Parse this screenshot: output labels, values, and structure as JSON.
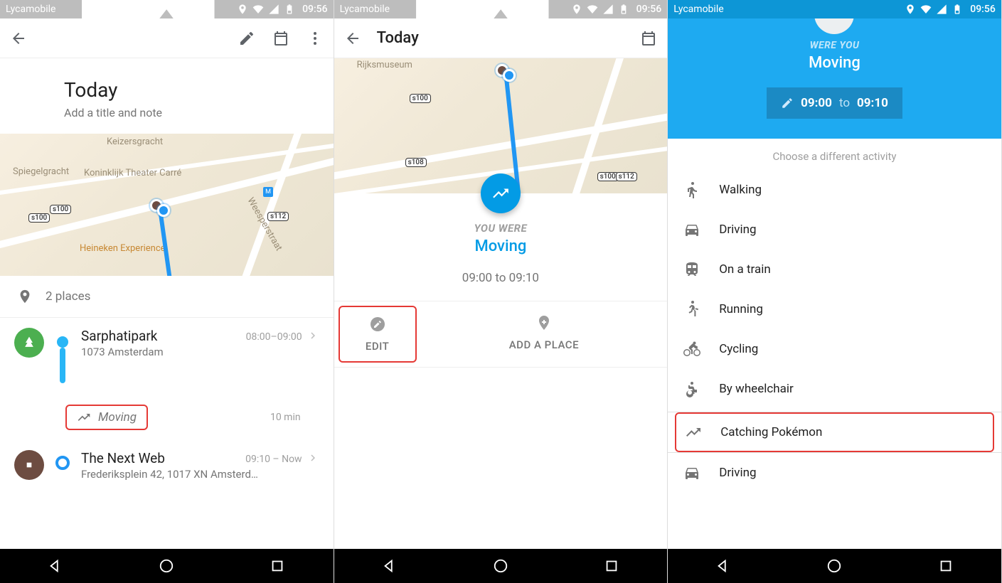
{
  "status": {
    "carrier": "Lycamobile",
    "time": "09:56"
  },
  "screen1": {
    "page_title": "Today",
    "subtitle": "Add a title and note",
    "places_count": "2 places",
    "map": {
      "labels": [
        "Koninklijk Theater Carré",
        "Spiegelgracht",
        "Keizersgracht",
        "Heineken Experience",
        "Weesperstraat"
      ],
      "shields": [
        "s100",
        "s100",
        "s112"
      ]
    },
    "entries": [
      {
        "title": "Sarphatipark",
        "sub": "1073 Amsterdam",
        "time": "08:00–09:00"
      },
      {
        "title": "The Next Web",
        "sub": "Frederiksplein 42, 1017 XN Amsterd…",
        "time": "09:10 – Now"
      }
    ],
    "moving": {
      "label": "Moving",
      "duration": "10 min"
    }
  },
  "screen2": {
    "appbar_title": "Today",
    "map": {
      "labels": [
        "Rijksmuseum"
      ],
      "shields": [
        "s100",
        "s108",
        "s100",
        "s112"
      ]
    },
    "eyebrow": "YOU WERE",
    "activity": "Moving",
    "time_range": "09:00 to 09:10",
    "actions": {
      "edit": "EDIT",
      "add_place": "ADD A PLACE"
    }
  },
  "screen3": {
    "eyebrow": "WERE YOU",
    "activity": "Moving",
    "time_from": "09:00",
    "time_to_word": "to",
    "time_to": "09:10",
    "hint": "Choose a different activity",
    "activities": [
      {
        "id": "walking",
        "label": "Walking"
      },
      {
        "id": "driving",
        "label": "Driving"
      },
      {
        "id": "train",
        "label": "On a train"
      },
      {
        "id": "running",
        "label": "Running"
      },
      {
        "id": "cycling",
        "label": "Cycling"
      },
      {
        "id": "wheelchair",
        "label": "By wheelchair"
      },
      {
        "id": "pokemon",
        "label": "Catching Pokémon"
      }
    ],
    "extra_after_divider": {
      "id": "driving2",
      "label": "Driving"
    }
  }
}
